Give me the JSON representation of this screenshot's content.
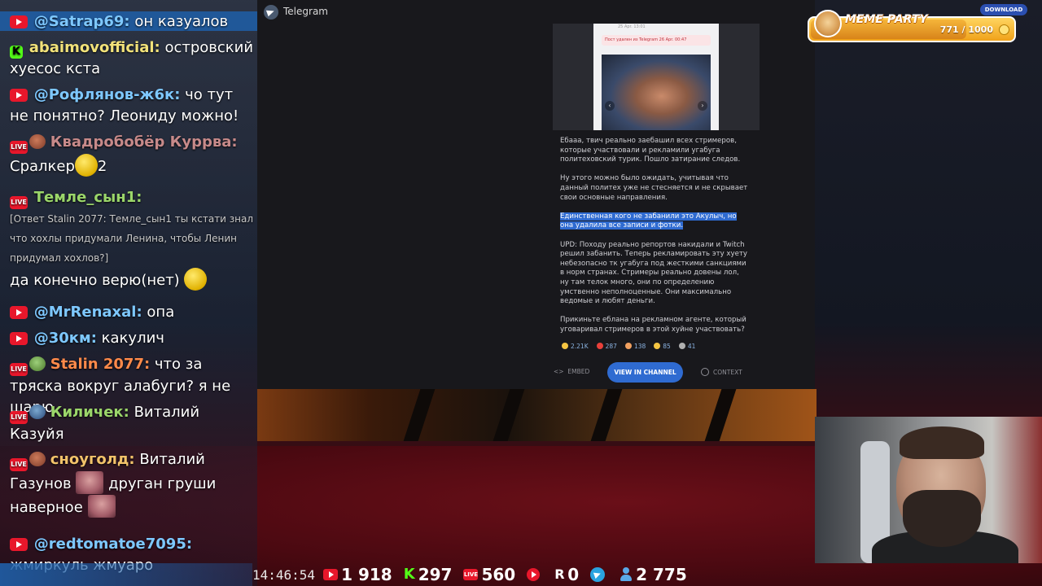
{
  "chat": {
    "messages": [
      {
        "platform": "youtube",
        "user": "@Satrap69:",
        "user_color": "#7ec8ff",
        "text": "он казуалов"
      },
      {
        "platform": "kick",
        "user": "abaimovofficial:",
        "user_color": "#f2e27a",
        "text": "островский хуесос кста"
      },
      {
        "platform": "youtube",
        "user": "@Рофлянов-ж6к:",
        "user_color": "#7ec8ff",
        "text": "чо тут не понятно? Леониду можно!"
      },
      {
        "platform": "vk",
        "user": "Квадробобёр Куррва:",
        "user_color": "#c78a8a",
        "text": "Сралкер",
        "suffix": "2",
        "emoji": "ball-emoji"
      },
      {
        "platform": "vk",
        "user": "Темле_сын1:",
        "user_color": "#9bd66a",
        "reply": "[Ответ Stalin 2077: Темле_сын1 ты кстати знал что хохлы придумали Ленина, чтобы Ленин придумал хохлов?]",
        "text": "да конечно верю(нет)",
        "emoji": "monocle-emoji"
      },
      {
        "platform": "youtube",
        "user": "@MrRenaxal:",
        "user_color": "#7ec8ff",
        "text": "опа"
      },
      {
        "platform": "youtube",
        "user": "@30км:",
        "user_color": "#7ec8ff",
        "text": "какулич"
      },
      {
        "platform": "vk",
        "user": "Stalin 2077:",
        "user_color": "#ff8a4a",
        "text": "что за тряска вокруг алабуги? я не шарю"
      },
      {
        "platform": "vk",
        "user": "Киличек:",
        "user_color": "#9bd66a",
        "text": "Виталий Казуйя"
      },
      {
        "platform": "vk",
        "user": "сноуголд:",
        "user_color": "#f2c36a",
        "text_a": "Виталий Газунов",
        "text_b": "друган груши",
        "text_c": "наверное"
      },
      {
        "platform": "youtube",
        "user": "@redtomatoe7095:",
        "user_color": "#7ec8ff",
        "text": "жмиркуль жмуаро"
      }
    ]
  },
  "telegram": {
    "app_title": "Telegram",
    "image": {
      "date_label": "25 Apr. 13:01",
      "pill_text": "Пост удален из Telegram 26 Apr. 00:47",
      "prev": "‹",
      "next": "›"
    },
    "paragraphs": [
      "Ебааа, твич реально заебашил всех стримеров, которые участвовали и рекламили угабуга политеховский турик. Пошло затирание следов.",
      "Ну этого можно было ожидать, учитывая что данный политех уже не стесняется и не скрывает свои основные направления.",
      "UPD: Походу реально репортов накидали и Twitch решил забанить. Теперь рекламировать эту хуету небезопасно тк угабуга под жесткими санкциями в норм странах. Стримеры реально довены лол, ну там телок много, они по определению умственно неполноценные. Они максимально ведомые и любят деньги.",
      "Прикиньте еблана на рекламном агенте, который уговаривал стримеров в этой хуйне участвовать?"
    ],
    "highlighted": "Единственная кого не забанили это Акулыч, но она удалила все записи и фотки.",
    "reactions": [
      {
        "icon": "laugh-emoji",
        "color": "#f5c542",
        "count": "2.21K"
      },
      {
        "icon": "heart-emoji",
        "color": "#e8403a",
        "count": "287"
      },
      {
        "icon": "shock-emoji",
        "color": "#f0a060",
        "count": "138"
      },
      {
        "icon": "thumbs-up-emoji",
        "color": "#f5c542",
        "count": "85"
      },
      {
        "icon": "tombstone-emoji",
        "color": "#b0b0b0",
        "count": "41"
      }
    ],
    "actions": {
      "embed": "EMBED",
      "view": "VIEW IN CHANNEL",
      "context": "CONTEXT"
    }
  },
  "meme_party": {
    "title": "MEME PARTY",
    "current": 771,
    "max": 1000,
    "count_text": "771 / 1000",
    "download_label": "DOWNLOAD"
  },
  "status": {
    "time": "14:46:54",
    "youtube": "1 918",
    "kick": "297",
    "vk": "560",
    "play": "",
    "rutube": "0",
    "telegram": "",
    "viewers": "2 775"
  }
}
